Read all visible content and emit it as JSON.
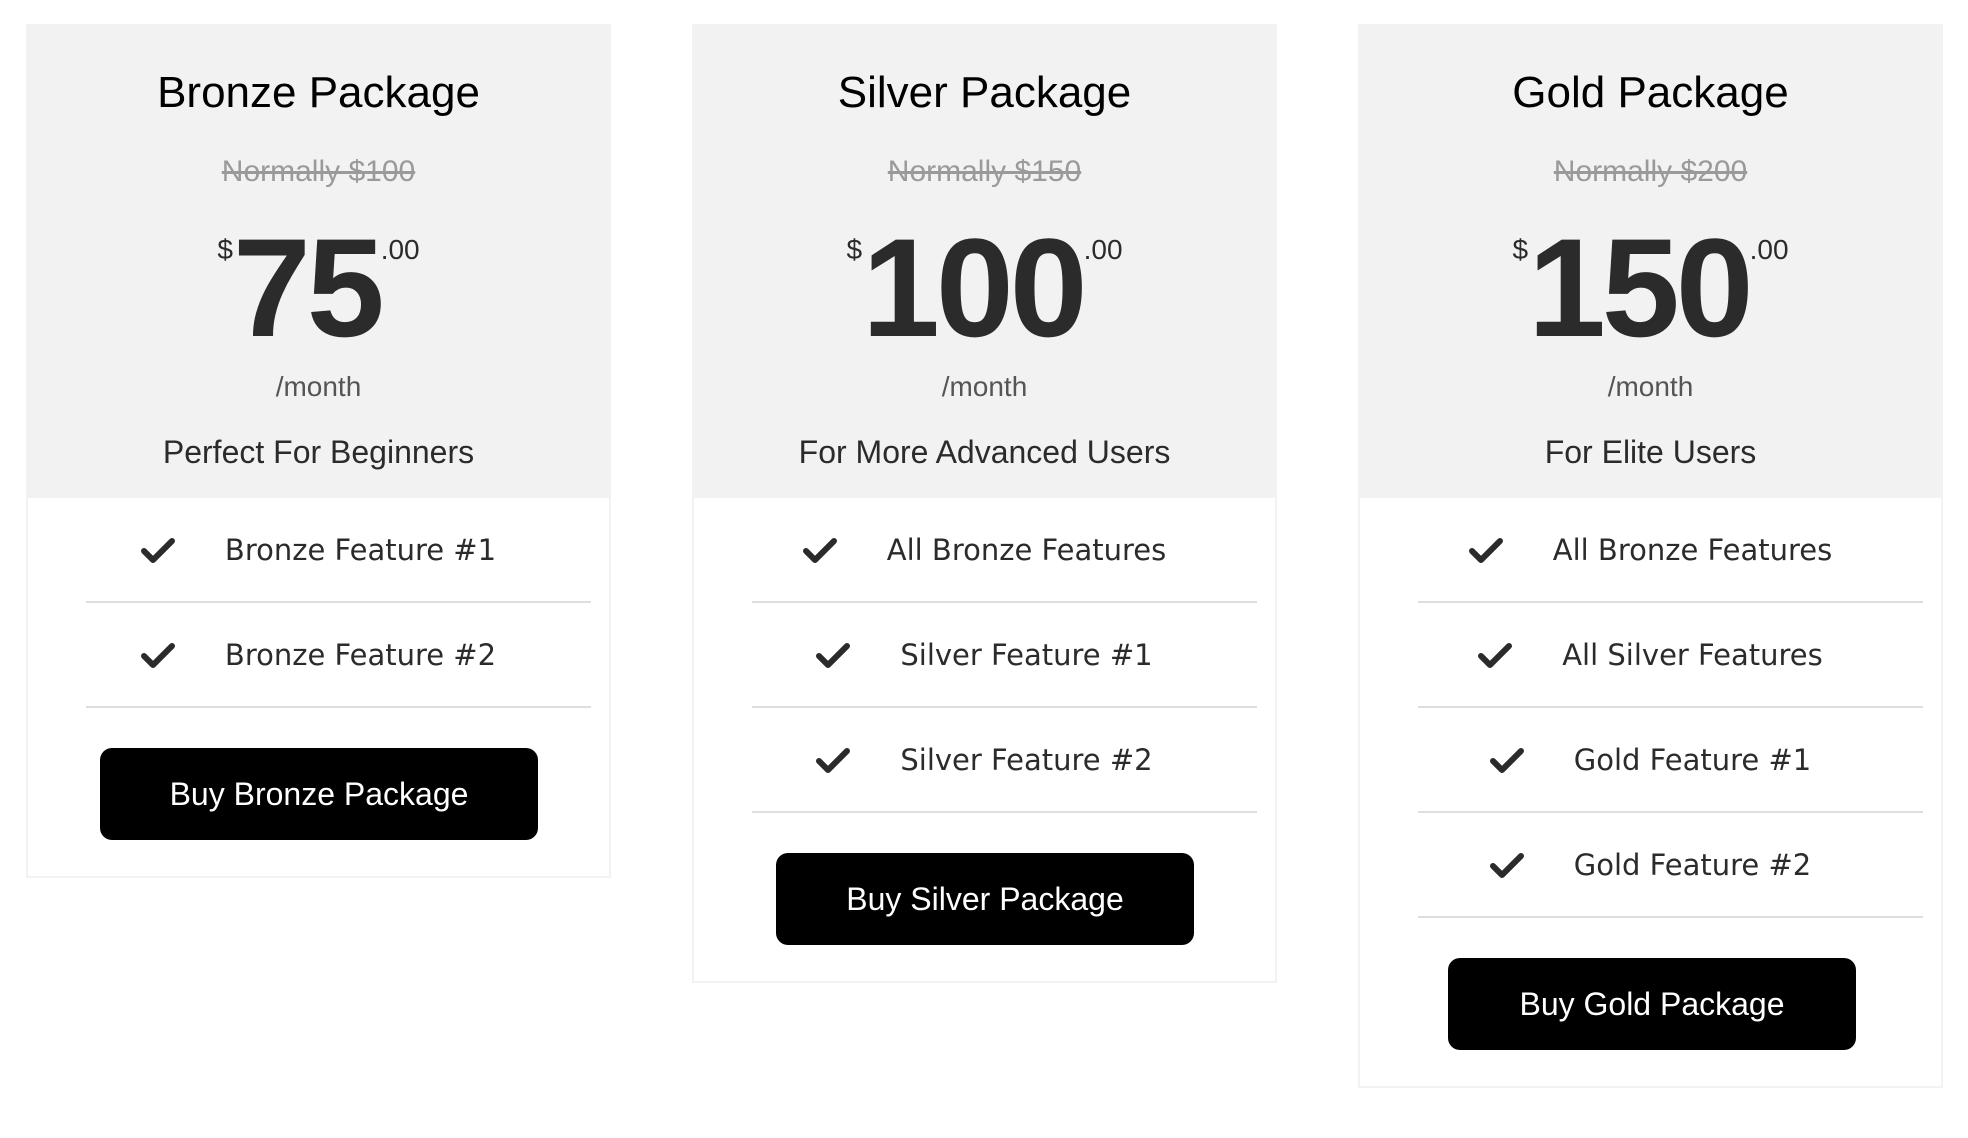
{
  "plans": [
    {
      "name": "Bronze Package",
      "normally": "Normally $100",
      "currency": "$",
      "price": "75",
      "cents": ".00",
      "period": "/month",
      "tagline": "Perfect For Beginners",
      "features": [
        "Bronze Feature #1",
        "Bronze Feature #2"
      ],
      "button": "Buy Bronze Package"
    },
    {
      "name": "Silver Package",
      "normally": "Normally $150",
      "currency": "$",
      "price": "100",
      "cents": ".00",
      "period": "/month",
      "tagline": "For More Advanced Users",
      "features": [
        "All Bronze Features",
        "Silver Feature #1",
        "Silver Feature #2"
      ],
      "button": "Buy Silver Package"
    },
    {
      "name": "Gold Package",
      "normally": "Normally $200",
      "currency": "$",
      "price": "150",
      "cents": ".00",
      "period": "/month",
      "tagline": "For Elite Users",
      "features": [
        "All Bronze Features",
        "All Silver Features",
        "Gold Feature #1",
        "Gold Feature #2"
      ],
      "button": "Buy Gold Package"
    }
  ],
  "icons": {
    "feature": "check-icon"
  },
  "colors": {
    "header_bg": "#f2f2f2",
    "button_bg": "#000000",
    "button_text": "#ffffff",
    "strike_text": "#9a9a9a",
    "divider": "#dedede"
  }
}
